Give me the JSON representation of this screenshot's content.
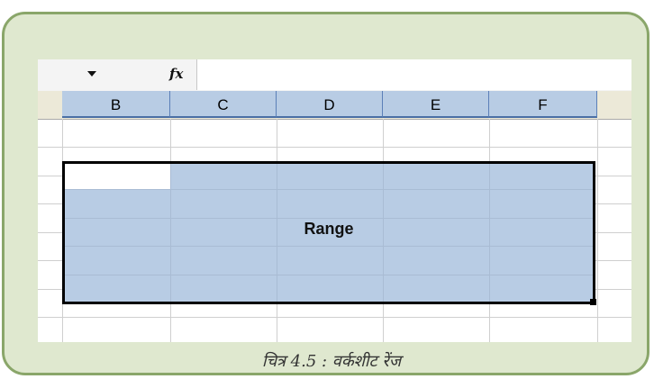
{
  "formula_bar": {
    "fx_label": "fx",
    "input_value": ""
  },
  "columns": [
    "B",
    "C",
    "D",
    "E",
    "F"
  ],
  "range": {
    "label": "Range"
  },
  "caption": "चित्र 4.5 : वर्कशीट रेंज",
  "colors": {
    "frame_bg": "#dfe8cf",
    "frame_border": "#8aa66a",
    "header_blue": "#b8cce4",
    "range_fill": "#b8cce4"
  }
}
